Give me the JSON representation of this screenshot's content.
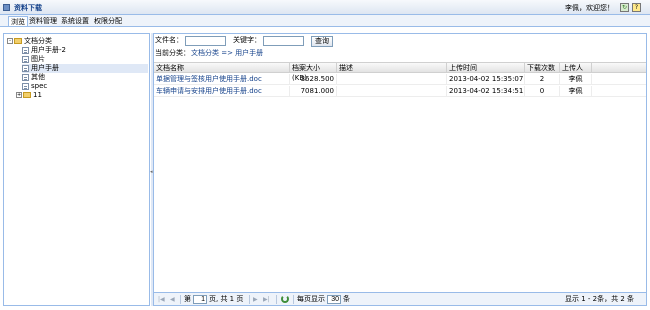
{
  "app": {
    "title": "资料下载",
    "welcome": "李佩，欢迎您！",
    "refresh_glyph": "↻",
    "help_glyph": "?"
  },
  "menu": {
    "items": [
      "浏览",
      "资料管理",
      "系统设置",
      "权限分配"
    ]
  },
  "tree": {
    "expand_glyph": "-",
    "collapse_glyph": "+",
    "root": "文档分类",
    "children": [
      "用户手册-2",
      "图片",
      "用户手册",
      "其他",
      "spec"
    ],
    "sibling": "11",
    "selected_index": 2
  },
  "filters": {
    "filename_label": "文件名：",
    "keyword_label": "关键字：",
    "filename_value": "",
    "keyword_value": "",
    "query_button": "查询"
  },
  "breadcrumb": {
    "label": "当前分类：",
    "path": "文档分类 => 用户手册"
  },
  "grid": {
    "columns": [
      "文档名称",
      "档案大小(KB)",
      "描述",
      "上传时间",
      "下载次数",
      "上传人"
    ],
    "rows": [
      [
        "单据管理与签核用户使用手册.doc",
        "3628.500",
        "",
        "2013-04-02 15:35:07",
        "2",
        "李佩"
      ],
      [
        "车辆申请与安排用户使用手册.doc",
        "7081.000",
        "",
        "2013-04-02 15:34:51",
        "0",
        "李佩"
      ]
    ]
  },
  "pager": {
    "first": "|◀",
    "prev": "◀",
    "next": "▶",
    "last": "▶|",
    "page_prefix": "第",
    "page_value": "1",
    "page_suffix": "页, 共 1 页",
    "per_page_label": "每页显示",
    "per_page_value": "30",
    "per_page_unit": "条",
    "summary": "显示 1 - 2条，共 2 条"
  }
}
